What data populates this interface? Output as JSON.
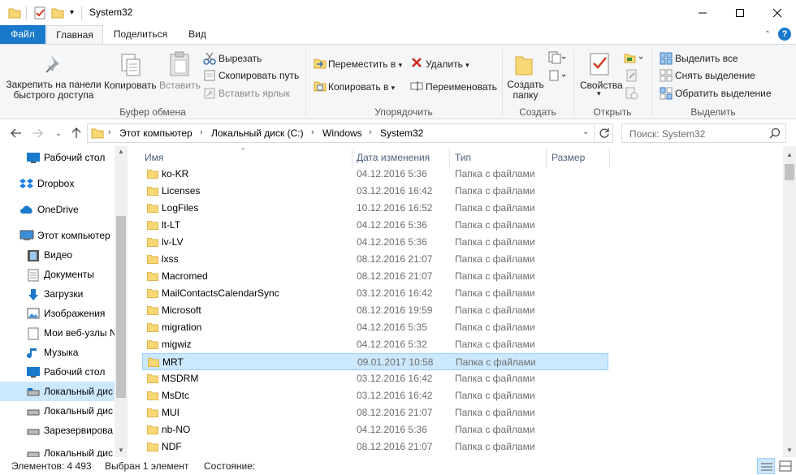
{
  "window": {
    "title": "System32",
    "colors": {
      "accent": "#1979ca",
      "selection": "#cce8ff",
      "folder": "#f8d775"
    }
  },
  "ribbon": {
    "tabs": {
      "file": "Файл",
      "home": "Главная",
      "share": "Поделиться",
      "view": "Вид"
    },
    "clipboard": {
      "pin": "Закрепить на панели быстрого доступа",
      "pin_line1": "Закрепить на панели",
      "pin_line2": "быстрого доступа",
      "copy": "Копировать",
      "paste": "Вставить",
      "cut": "Вырезать",
      "copy_path": "Скопировать путь",
      "paste_shortcut": "Вставить ярлык",
      "label": "Буфер обмена"
    },
    "organize": {
      "move_to": "Переместить в",
      "copy_to": "Копировать в",
      "delete": "Удалить",
      "rename": "Переименовать",
      "label": "Упорядочить"
    },
    "new": {
      "new_folder_line1": "Создать",
      "new_folder_line2": "папку",
      "label": "Создать"
    },
    "open": {
      "properties": "Свойства",
      "label": "Открыть"
    },
    "select": {
      "select_all": "Выделить все",
      "select_none": "Снять выделение",
      "invert": "Обратить выделение",
      "label": "Выделить"
    }
  },
  "address": {
    "crumbs": [
      "Этот компьютер",
      "Локальный диск (C:)",
      "Windows",
      "System32"
    ],
    "search_placeholder": "Поиск: System32"
  },
  "nav": {
    "items": [
      {
        "label": "Рабочий стол",
        "icon": "desktop-icon"
      },
      {
        "label": "Dropbox",
        "icon": "dropbox-icon"
      },
      {
        "label": "OneDrive",
        "icon": "onedrive-icon"
      },
      {
        "label": "Этот компьютер",
        "icon": "computer-icon"
      },
      {
        "label": "Видео",
        "icon": "video-icon"
      },
      {
        "label": "Документы",
        "icon": "documents-icon"
      },
      {
        "label": "Загрузки",
        "icon": "downloads-icon"
      },
      {
        "label": "Изображения",
        "icon": "pictures-icon"
      },
      {
        "label": "Мои веб-узлы N",
        "icon": "web-folder-icon"
      },
      {
        "label": "Музыка",
        "icon": "music-icon"
      },
      {
        "label": "Рабочий стол",
        "icon": "desktop-icon"
      },
      {
        "label": "Локальный дис",
        "icon": "drive-icon"
      },
      {
        "label": "Локальный дис",
        "icon": "drive-icon"
      },
      {
        "label": "Зарезервирова",
        "icon": "drive-icon"
      },
      {
        "label": "Локальный дис",
        "icon": "drive-icon"
      }
    ]
  },
  "list": {
    "columns": {
      "name": "Имя",
      "date": "Дата изменения",
      "type": "Тип",
      "size": "Размер"
    },
    "rows": [
      {
        "name": "ko-KR",
        "date": "04.12.2016 5:36",
        "type": "Папка с файлами"
      },
      {
        "name": "Licenses",
        "date": "03.12.2016 16:42",
        "type": "Папка с файлами"
      },
      {
        "name": "LogFiles",
        "date": "10.12.2016 16:52",
        "type": "Папка с файлами"
      },
      {
        "name": "lt-LT",
        "date": "04.12.2016 5:36",
        "type": "Папка с файлами"
      },
      {
        "name": "lv-LV",
        "date": "04.12.2016 5:36",
        "type": "Папка с файлами"
      },
      {
        "name": "lxss",
        "date": "08.12.2016 21:07",
        "type": "Папка с файлами"
      },
      {
        "name": "Macromed",
        "date": "08.12.2016 21:07",
        "type": "Папка с файлами"
      },
      {
        "name": "MailContactsCalendarSync",
        "date": "03.12.2016 16:42",
        "type": "Папка с файлами"
      },
      {
        "name": "Microsoft",
        "date": "08.12.2016 19:59",
        "type": "Папка с файлами"
      },
      {
        "name": "migration",
        "date": "04.12.2016 5:35",
        "type": "Папка с файлами"
      },
      {
        "name": "migwiz",
        "date": "04.12.2016 5:32",
        "type": "Папка с файлами"
      },
      {
        "name": "MRT",
        "date": "09.01.2017 10:58",
        "type": "Папка с файлами"
      },
      {
        "name": "MSDRM",
        "date": "03.12.2016 16:42",
        "type": "Папка с файлами"
      },
      {
        "name": "MsDtc",
        "date": "03.12.2016 16:42",
        "type": "Папка с файлами"
      },
      {
        "name": "MUI",
        "date": "08.12.2016 21:07",
        "type": "Папка с файлами"
      },
      {
        "name": "nb-NO",
        "date": "04.12.2016 5:36",
        "type": "Папка с файлами"
      },
      {
        "name": "NDF",
        "date": "08.12.2016 21:07",
        "type": "Папка с файлами"
      }
    ]
  },
  "status": {
    "items": "Элементов: 4 493",
    "selected": "Выбран 1 элемент",
    "state": "Состояние:"
  }
}
